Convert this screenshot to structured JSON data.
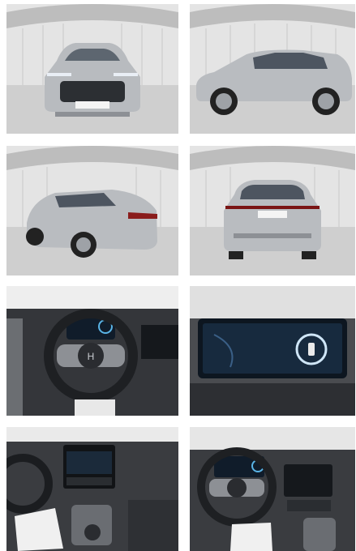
{
  "gallery": {
    "photos": [
      {
        "view": "front-exterior",
        "plate_text": ""
      },
      {
        "view": "side-exterior"
      },
      {
        "view": "rear-three-quarter-exterior"
      },
      {
        "view": "rear-exterior"
      },
      {
        "view": "dashboard-steering-wheel"
      },
      {
        "view": "infotainment-screen-closeup"
      },
      {
        "view": "center-console"
      },
      {
        "view": "interior-steering-console"
      }
    ]
  },
  "colors": {
    "studio_wall": "#e6e6e6",
    "studio_floor": "#c9c9c9",
    "car_silver": "#b9bcc0",
    "interior_dark": "#2b2d30",
    "screen_blue": "#1a3a5a"
  }
}
